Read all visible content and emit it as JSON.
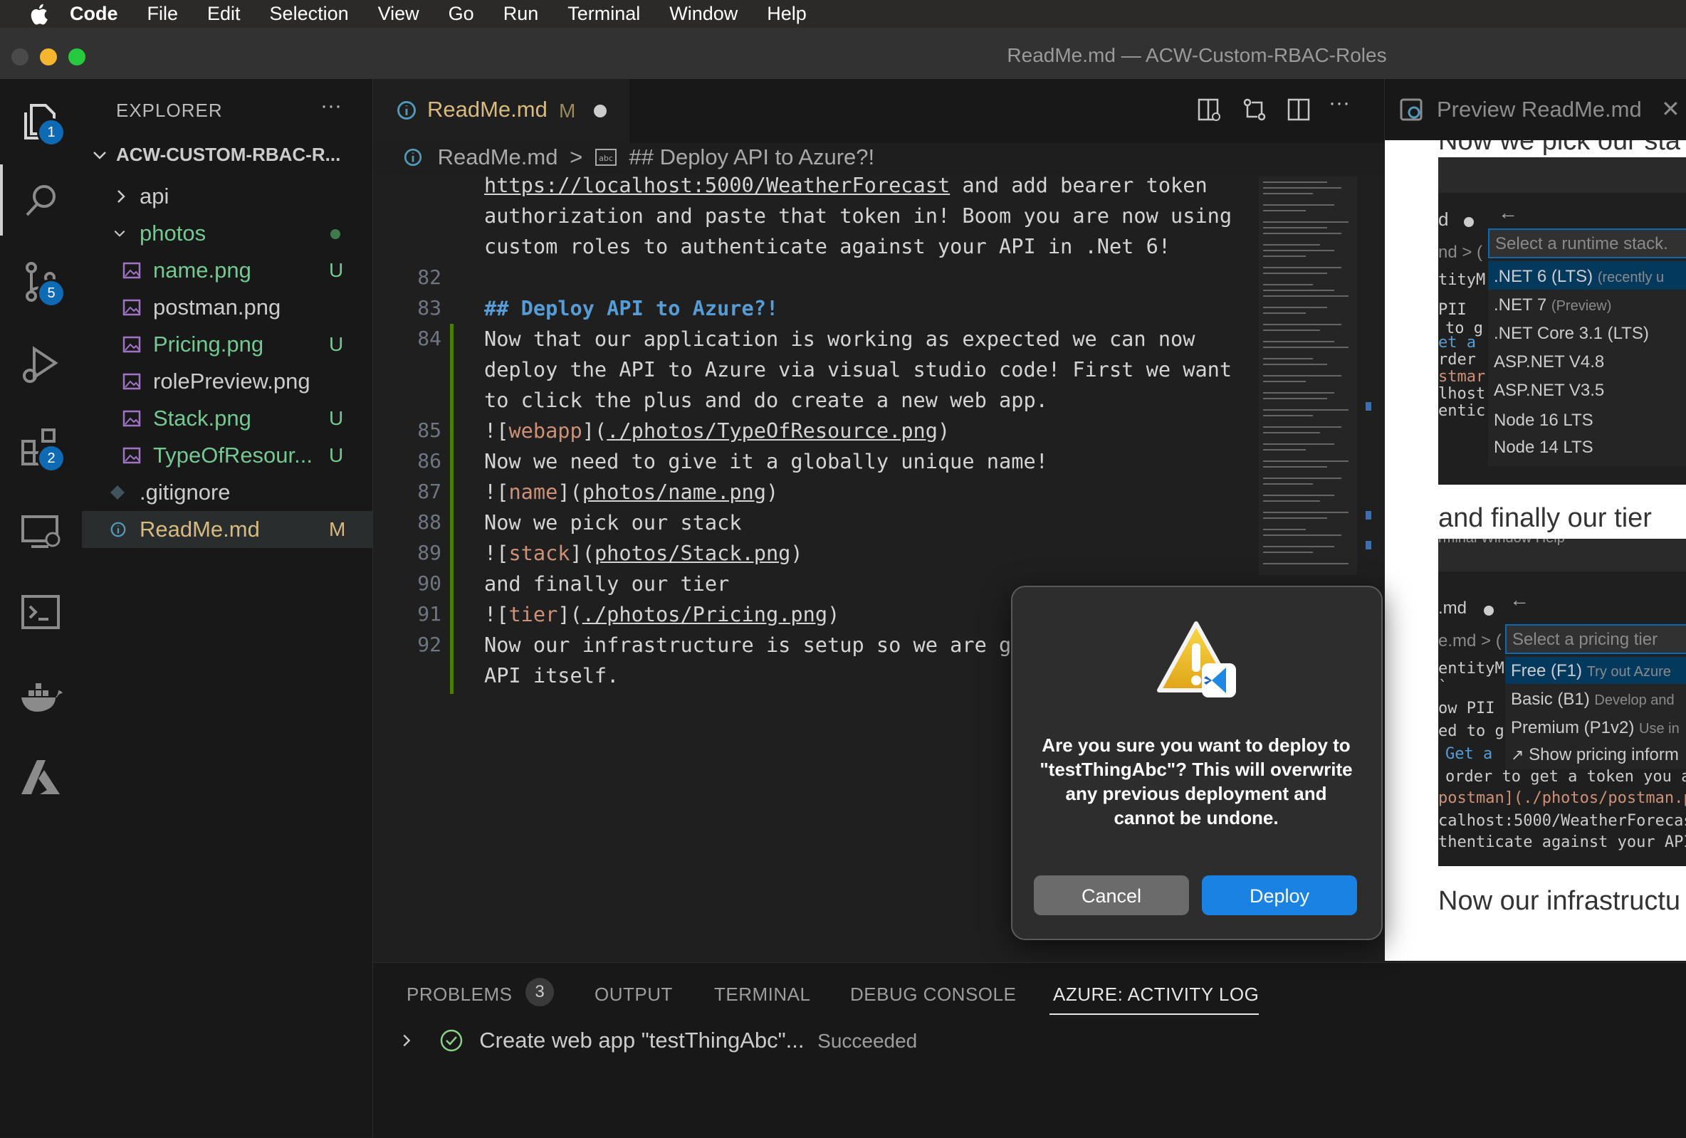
{
  "menubar": {
    "app": "Code",
    "items": [
      "File",
      "Edit",
      "Selection",
      "View",
      "Go",
      "Run",
      "Terminal",
      "Window",
      "Help"
    ]
  },
  "window": {
    "title": "ReadMe.md — ACW-Custom-RBAC-Roles"
  },
  "activity_bar": {
    "explorer_badge": "1",
    "source_control_badge": "5",
    "extensions_badge": "2",
    "icons": [
      "files-icon",
      "search-icon",
      "source-control-icon",
      "run-debug-icon",
      "extensions-icon",
      "remote-explorer-icon",
      "terminal-icon",
      "docker-icon",
      "azure-icon"
    ]
  },
  "sidebar": {
    "title": "EXPLORER",
    "more": "···",
    "root": "ACW-CUSTOM-RBAC-R...",
    "items": [
      {
        "label": "api",
        "status": ""
      },
      {
        "label": "photos",
        "status": ""
      },
      {
        "label": "name.png",
        "status": "U"
      },
      {
        "label": "postman.png",
        "status": ""
      },
      {
        "label": "Pricing.png",
        "status": "U"
      },
      {
        "label": "rolePreview.png",
        "status": ""
      },
      {
        "label": "Stack.png",
        "status": "U"
      },
      {
        "label": "TypeOfResour...",
        "status": "U"
      },
      {
        "label": ".gitignore",
        "status": ""
      },
      {
        "label": "ReadMe.md",
        "status": "M"
      }
    ]
  },
  "editor": {
    "tab": {
      "label": "ReadMe.md",
      "status": "M"
    },
    "breadcrumb": {
      "file": "ReadMe.md",
      "sep": ">",
      "symbol": "## Deploy API to Azure?!"
    },
    "lines": [
      {
        "n": "",
        "text": "https://localhost:5000/WeatherForecast and add bearer token"
      },
      {
        "n": "",
        "text": "authorization and paste that token in! Boom you are now using"
      },
      {
        "n": "",
        "text": "custom roles to authenticate against your API in .Net 6!"
      },
      {
        "n": "82",
        "text": ""
      },
      {
        "n": "83",
        "text": "## Deploy API to Azure?!"
      },
      {
        "n": "84",
        "text": "Now that our application is working as expected we can now"
      },
      {
        "n": "",
        "text": "deploy the API to Azure via visual studio code! First we want"
      },
      {
        "n": "",
        "text": "to click the plus and do create a new web app."
      },
      {
        "n": "85",
        "text": "![webapp](./photos/TypeOfResource.png)"
      },
      {
        "n": "86",
        "text": "Now we need to give it a globally unique name!"
      },
      {
        "n": "87",
        "text": "![name](photos/name.png)"
      },
      {
        "n": "88",
        "text": "Now we pick our stack"
      },
      {
        "n": "89",
        "text": "![stack](photos/Stack.png)"
      },
      {
        "n": "90",
        "text": "and finally our tier"
      },
      {
        "n": "91",
        "text": "![tier](./photos/Pricing.png)"
      },
      {
        "n": "92",
        "text": "Now our infrastructure is setup so we are g"
      },
      {
        "n": "",
        "text": "API itself."
      }
    ],
    "link_parts": {
      "url": "https://localhost:5000/WeatherForecast",
      "url_rest": " and add bearer token",
      "webapp_alt": "webapp",
      "webapp_path": "./photos/TypeOfResource.png",
      "name_alt": "name",
      "name_path": "photos/name.png",
      "stack_alt": "stack",
      "stack_path": "photos/Stack.png",
      "tier_alt": "tier",
      "tier_path": "./photos/Pricing.png"
    }
  },
  "preview": {
    "title": "Preview ReadMe.md",
    "top_text": "Now we pick our sta",
    "tier_text": "and finally our tier",
    "bottom_text": "Now our infrastructu",
    "stack_shot": {
      "tab_frag": "d",
      "crumb_frag": "nd > (",
      "code_frags": [
        "tityM",
        "PII",
        "to g",
        "et a",
        "rder",
        "stmar",
        "lhost",
        "entic"
      ],
      "placeholder": "Select a runtime stack.",
      "options": [
        {
          "label": ".NET 6 (LTS)",
          "desc": "(recently u"
        },
        {
          "label": ".NET 7",
          "desc": "(Preview)"
        },
        {
          "label": ".NET Core 3.1 (LTS)",
          "desc": ""
        },
        {
          "label": "ASP.NET V4.8",
          "desc": ""
        },
        {
          "label": "ASP.NET V3.5",
          "desc": ""
        },
        {
          "label": "Node 16 LTS",
          "desc": ""
        },
        {
          "label": "Node 14 LTS",
          "desc": ""
        }
      ]
    },
    "tier_shot": {
      "menu_frag": "rminal    Window    Help",
      "tab_frag": ".md",
      "crumb_frag": "e.md > (",
      "code_frags": [
        "entityM",
        "`",
        "ow PII",
        "ed to g",
        "Get a",
        "order to get a token you a",
        "postman](./photos/postman.p",
        "calhost:5000/WeatherForecas",
        "thenticate against your API"
      ],
      "placeholder": "Select a pricing tier",
      "options": [
        {
          "label": "Free (F1)",
          "desc": "Try out Azure"
        },
        {
          "label": "Basic (B1)",
          "desc": "Develop and"
        },
        {
          "label": "Premium (P1v2)",
          "desc": "Use in"
        },
        {
          "label": "Show pricing inform",
          "desc": ""
        }
      ]
    }
  },
  "panel": {
    "tabs": [
      {
        "label": "PROBLEMS",
        "count": "3"
      },
      {
        "label": "OUTPUT"
      },
      {
        "label": "TERMINAL"
      },
      {
        "label": "DEBUG CONSOLE"
      },
      {
        "label": "AZURE: ACTIVITY LOG"
      }
    ],
    "log": {
      "text": "Create web app \"testThingAbc\"...",
      "status": "Succeeded"
    }
  },
  "dialog": {
    "message": "Are you sure you want to deploy to \"testThingAbc\"? This will overwrite any previous deployment and cannot be undone.",
    "cancel": "Cancel",
    "deploy": "Deploy"
  },
  "colors": {
    "accent": "#0f6ab4",
    "deploy_button": "#1a82e3",
    "untracked": "#73c991",
    "modified": "#d7ba7d",
    "heading": "#569cd6",
    "link": "#ce9178"
  }
}
